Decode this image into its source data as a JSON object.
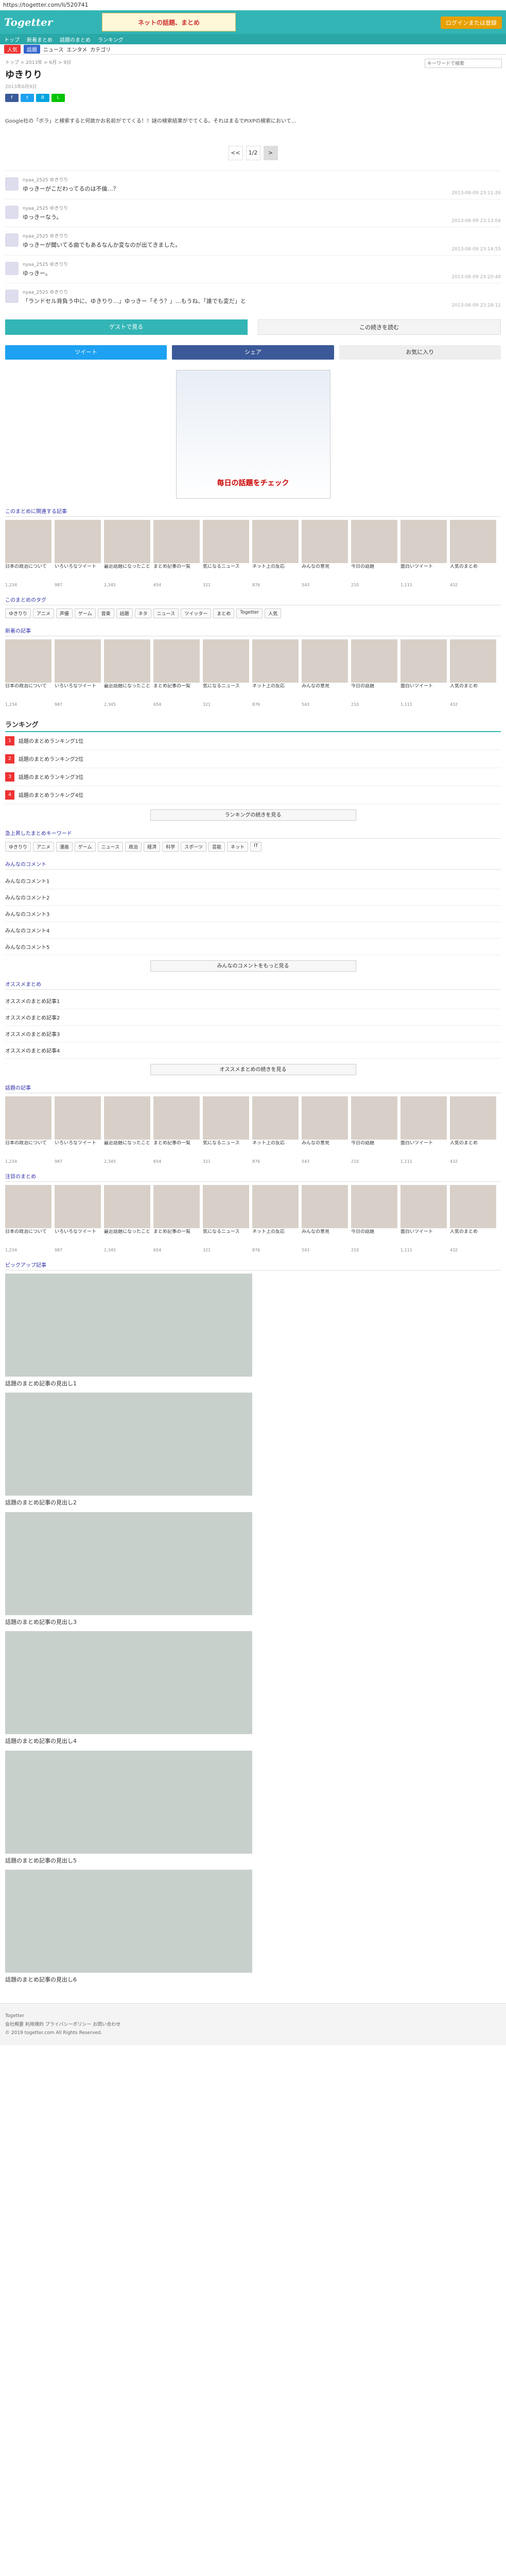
{
  "url": "https://togetter.com/li/520741",
  "header": {
    "logo": "Togetter",
    "banner": "ネットの話題、まとめ",
    "login_btn": "ログインまたは登録"
  },
  "nav1": [
    "トップ",
    "新着まとめ",
    "話題のまとめ",
    "ランキング"
  ],
  "nav2": [
    "人気",
    "話題",
    "ニュース",
    "エンタメ",
    "カテゴリ"
  ],
  "search_placeholder": "キーワードで検索",
  "breadcrumb": "トップ > 2013年 > 6月 > 9日",
  "page_title": "ゆきりり",
  "subline": "2013年6月9日",
  "share": [
    "f",
    "t",
    "B",
    "L"
  ],
  "description": "Google社の「ボラ」と検索すると何故かお名前がでてくる！！謎の検索結果がでてくる。それはまるでPIXPの検索において…",
  "pager": {
    "current": "1/2",
    "prev": "<<",
    "next": ">"
  },
  "tweets": [
    {
      "user": "nyaa_2525 ゆきりり",
      "body": "ゆっきーがこだわってるのは不倫…？",
      "time": "2013-06-09 23:11:26"
    },
    {
      "user": "nyaa_2525 ゆきりり",
      "body": "ゆっきーなう。",
      "time": "2013-06-09 23:13:04"
    },
    {
      "user": "nyaa_2525 ゆきりり",
      "body": "ゆっきーが聞いてる曲でもあるなんか変なのが出てきました。",
      "time": "2013-06-09 23:14:55"
    },
    {
      "user": "nyaa_2525 ゆきりり",
      "body": "ゆっきー。",
      "time": "2013-06-09 23:20:40"
    },
    {
      "user": "nyaa_2525 ゆきりり",
      "body": "「ランドセル背負う中に、ゆきりり…」ゆっきー「そう？」…もうね、「誰でも変だ」と",
      "time": "2013-06-09 23:28:11"
    }
  ],
  "cta": {
    "left": "ゲストで見る",
    "right": "この続きを読む"
  },
  "bigshare": [
    "ツイート",
    "シェア",
    "お気に入り"
  ],
  "ad_text": "毎日の話題をチェック",
  "section_titles": {
    "related": "このまとめに関連する記事",
    "tags": "このまとめのタグ",
    "new": "新着の記事",
    "ranking": "ランキング",
    "keywords": "急上昇したまとめキーワード",
    "comments": "みんなのコメント",
    "recommend": "オススメまとめ",
    "latest": "話題の記事",
    "feature": "注目のまとめ",
    "more": "ピックアップ記事"
  },
  "related_cards": [
    {
      "cap": "日本の政治について",
      "cnt": "1,234"
    },
    {
      "cap": "いろいろなツイート",
      "cnt": "987"
    },
    {
      "cap": "最近話題になったこと",
      "cnt": "2,345"
    },
    {
      "cap": "まとめ記事の一覧",
      "cnt": "654"
    },
    {
      "cap": "気になるニュース",
      "cnt": "321"
    },
    {
      "cap": "ネット上の反応",
      "cnt": "876"
    },
    {
      "cap": "みんなの意見",
      "cnt": "543"
    },
    {
      "cap": "今日の話題",
      "cnt": "210"
    },
    {
      "cap": "面白いツイート",
      "cnt": "1,111"
    },
    {
      "cap": "人気のまとめ",
      "cnt": "432"
    }
  ],
  "tags": [
    "ゆきりり",
    "アニメ",
    "声優",
    "ゲーム",
    "音楽",
    "話題",
    "ネタ",
    "ニュース",
    "ツイッター",
    "まとめ",
    "Togetter",
    "人気"
  ],
  "ranking": [
    {
      "num": "1",
      "text": "話題のまとめランキング1位"
    },
    {
      "num": "2",
      "text": "話題のまとめランキング2位"
    },
    {
      "num": "3",
      "text": "話題のまとめランキング3位"
    },
    {
      "num": "4",
      "text": "話題のまとめランキング4位"
    }
  ],
  "more_btn": "ランキングの続きを見る",
  "keyword_tags": [
    "ゆきりり",
    "アニメ",
    "漫画",
    "ゲーム",
    "ニュース",
    "政治",
    "経済",
    "科学",
    "スポーツ",
    "芸能",
    "ネット",
    "IT"
  ],
  "comments": [
    "みんなのコメント1",
    "みんなのコメント2",
    "みんなのコメント3",
    "みんなのコメント4",
    "みんなのコメント5"
  ],
  "comments_more": "みんなのコメントをもっと見る",
  "recommend": [
    "オススメのまとめ記事1",
    "オススメのまとめ記事2",
    "オススメのまとめ記事3",
    "オススメのまとめ記事4"
  ],
  "recommend_more": "オススメまとめの続きを見る",
  "bigcards": [
    {
      "cap": "話題のまとめ記事の見出し1"
    },
    {
      "cap": "話題のまとめ記事の見出し2"
    },
    {
      "cap": "話題のまとめ記事の見出し3"
    },
    {
      "cap": "話題のまとめ記事の見出し4"
    },
    {
      "cap": "話題のまとめ記事の見出し5"
    },
    {
      "cap": "話題のまとめ記事の見出し6"
    }
  ],
  "footer": {
    "l1": "Togetter",
    "l2": "会社概要 利用規約 プライバシーポリシー お問い合わせ",
    "l3": "© 2019 togetter.com All Rights Reserved."
  },
  "colors": {
    "brand": "#33b5b5",
    "facebook": "#3b5998",
    "twitter": "#1da1f2",
    "hatena": "#00a4de",
    "line": "#00c300"
  }
}
